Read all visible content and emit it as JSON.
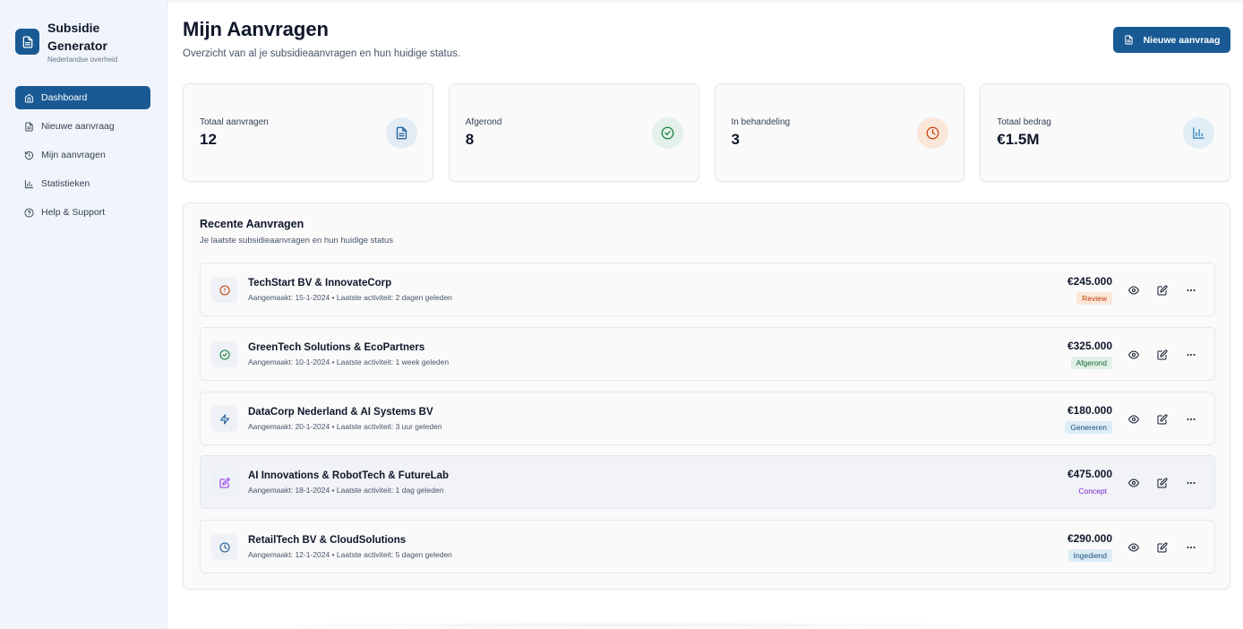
{
  "brand": {
    "title": "Subsidie Generator",
    "subtitle": "Nederlandse overheid"
  },
  "nav": [
    {
      "label": "Dashboard",
      "icon": "home-icon",
      "active": true
    },
    {
      "label": "Nieuwe aanvraag",
      "icon": "file-icon",
      "active": false
    },
    {
      "label": "Mijn aanvragen",
      "icon": "history-icon",
      "active": false
    },
    {
      "label": "Statistieken",
      "icon": "bar-chart-icon",
      "active": false
    },
    {
      "label": "Help & Support",
      "icon": "help-circle-icon",
      "active": false
    }
  ],
  "header": {
    "title": "Mijn Aanvragen",
    "subtitle": "Overzicht van al je subsidieaanvragen en hun huidige status.",
    "new_button": "Nieuwe aanvraag"
  },
  "stats": [
    {
      "label": "Totaal aanvragen",
      "value": "12",
      "icon": "file-icon",
      "color": "#1a5a94",
      "bg": "#e3ecf5"
    },
    {
      "label": "Afgerond",
      "value": "8",
      "icon": "check-circle-icon",
      "color": "#15803d",
      "bg": "#e3f1ea"
    },
    {
      "label": "In behandeling",
      "value": "3",
      "icon": "clock-icon",
      "color": "#c2410c",
      "bg": "#fbe6da"
    },
    {
      "label": "Totaal bedrag",
      "value": "€1.5M",
      "icon": "bar-chart-icon",
      "color": "#2a7fb8",
      "bg": "#e1eef6"
    }
  ],
  "recent": {
    "title": "Recente Aanvragen",
    "subtitle": "Je laatste subsidieaanvragen en hun huidige status",
    "rows": [
      {
        "name": "TechStart BV & InnovateCorp",
        "meta": "Aangemaakt: 15-1-2024 • Laatste activiteit: 2 dagen geleden",
        "amount": "€245.000",
        "status": "Review",
        "icon": "alert-circle-icon",
        "icon_color": "#c2410c",
        "badge_color": "#c2410c",
        "badge_bg": "#fbe8d9",
        "highlight": false
      },
      {
        "name": "GreenTech Solutions & EcoPartners",
        "meta": "Aangemaakt: 10-1-2024 • Laatste activiteit: 1 week geleden",
        "amount": "€325.000",
        "status": "Afgerond",
        "icon": "check-circle-icon",
        "icon_color": "#15803d",
        "badge_color": "#166534",
        "badge_bg": "#dff0e6",
        "highlight": false
      },
      {
        "name": "DataCorp Nederland & AI Systems BV",
        "meta": "Aangemaakt: 20-1-2024 • Laatste activiteit: 3 uur geleden",
        "amount": "€180.000",
        "status": "Genereren",
        "icon": "zap-icon",
        "icon_color": "#1a5a94",
        "badge_color": "#1e4f7a",
        "badge_bg": "#dcedf7",
        "highlight": false
      },
      {
        "name": "AI Innovations & RobotTech & FutureLab",
        "meta": "Aangemaakt: 18-1-2024 • Laatste activiteit: 1 dag geleden",
        "amount": "€475.000",
        "status": "Concept",
        "icon": "edit-icon",
        "icon_color": "#9333ea",
        "badge_color": "#7e22ce",
        "badge_bg": "transparent",
        "highlight": true
      },
      {
        "name": "RetailTech BV & CloudSolutions",
        "meta": "Aangemaakt: 12-1-2024 • Laatste activiteit: 5 dagen geleden",
        "amount": "€290.000",
        "status": "Ingediend",
        "icon": "clock-icon",
        "icon_color": "#1a5a94",
        "badge_color": "#1e4f7a",
        "badge_bg": "#dcedf7",
        "highlight": false
      }
    ]
  }
}
